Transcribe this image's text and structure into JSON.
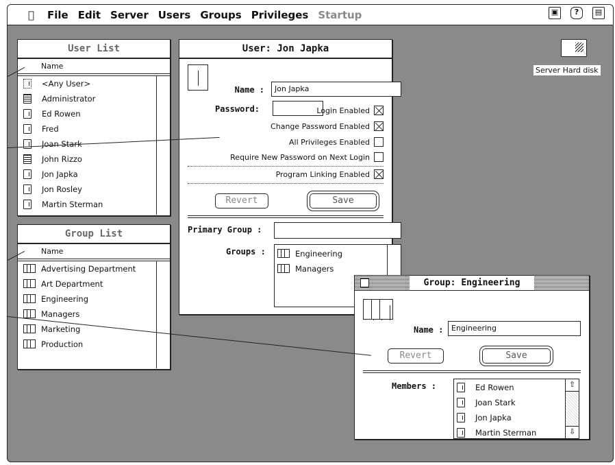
{
  "menubar": {
    "items": [
      {
        "label": "File",
        "enabled": true
      },
      {
        "label": "Edit",
        "enabled": true
      },
      {
        "label": "Server",
        "enabled": true
      },
      {
        "label": "Users",
        "enabled": true
      },
      {
        "label": "Groups",
        "enabled": true
      },
      {
        "label": "Privileges",
        "enabled": true
      },
      {
        "label": "Startup",
        "enabled": false
      }
    ],
    "right_icons": [
      "file-share-icon",
      "help-icon",
      "application-menu-icon"
    ]
  },
  "desktop": {
    "disk_label": "Server Hard disk"
  },
  "user_list": {
    "title": "User List",
    "column": "Name",
    "rows": [
      {
        "name": "<Any User>",
        "icon": "any-user-icon"
      },
      {
        "name": "Administrator",
        "icon": "admin-icon"
      },
      {
        "name": "Ed Rowen",
        "icon": "user-icon"
      },
      {
        "name": "Fred",
        "icon": "user-icon"
      },
      {
        "name": "Joan Stark",
        "icon": "user-icon"
      },
      {
        "name": "John Rizzo",
        "icon": "admin-icon"
      },
      {
        "name": "Jon Japka",
        "icon": "user-icon"
      },
      {
        "name": "Jon Rosley",
        "icon": "user-icon"
      },
      {
        "name": "Martin Sterman",
        "icon": "user-icon"
      }
    ]
  },
  "group_list": {
    "title": "Group List",
    "column": "Name",
    "rows": [
      "Advertising Department",
      "Art Department",
      "Engineering",
      "Managers",
      "Marketing",
      "Production"
    ]
  },
  "user_window": {
    "title": "User: Jon Japka",
    "name_label": "Name :",
    "name_value": "Jon Japka",
    "password_label": "Password:",
    "password_value": "",
    "checks": [
      {
        "label": "Login Enabled",
        "checked": true
      },
      {
        "label": "Change Password Enabled",
        "checked": true
      },
      {
        "label": "All Privileges Enabled",
        "checked": false
      },
      {
        "label": "Require New Password on Next Login",
        "checked": false
      }
    ],
    "program_linking": {
      "label": "Program Linking Enabled",
      "checked": true
    },
    "revert_label": "Revert",
    "save_label": "Save",
    "primary_group_label": "Primary Group :",
    "primary_group_value": "",
    "groups_label": "Groups :",
    "groups": [
      "Engineering",
      "Managers"
    ]
  },
  "group_window": {
    "title": "Group: Engineering",
    "name_label": "Name :",
    "name_value": "Engineering",
    "revert_label": "Revert",
    "save_label": "Save",
    "members_label": "Members :",
    "members": [
      "Ed Rowen",
      "Joan Stark",
      "Jon Japka",
      "Martin Sterman"
    ]
  }
}
